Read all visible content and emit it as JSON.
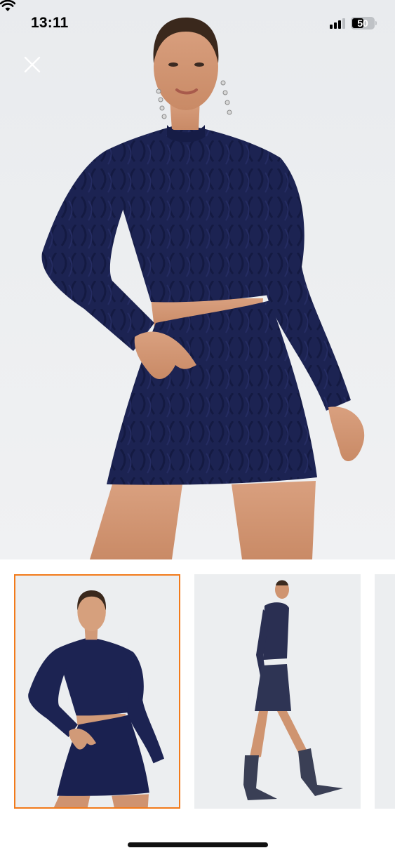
{
  "status_bar": {
    "time": "13:11",
    "battery_level": "50",
    "signal_bars_active": 3,
    "signal_bars_total": 4
  },
  "viewer": {
    "close_icon": "close-icon",
    "main_image": "product-photo-model-front-navy-cable-knit-set",
    "thumbnails": [
      {
        "name": "model-front-navy-cable-knit-set",
        "selected": true
      },
      {
        "name": "model-side-walking-navy-set-boots",
        "selected": false
      },
      {
        "name": "next-image-partial",
        "selected": false
      }
    ]
  },
  "colors": {
    "accent": "#f27a1a",
    "garment": "#1b2150",
    "background": "#eceef0"
  }
}
